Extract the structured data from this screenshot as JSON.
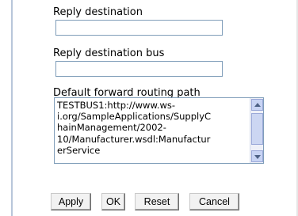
{
  "fields": {
    "reply_destination": {
      "label": "Reply destination",
      "value": ""
    },
    "reply_destination_bus": {
      "label": "Reply destination bus",
      "value": ""
    },
    "default_forward_routing_path": {
      "label": "Default forward routing path",
      "value": "TESTBUS1:http://www.ws-\ni.org/SampleApplications/SupplyC\nhainManagement/2002-\n10/Manufacturer.wsdl:Manufactur\nerService"
    }
  },
  "buttons": {
    "apply": "Apply",
    "ok": "OK",
    "reset": "Reset",
    "cancel": "Cancel"
  },
  "icons": {
    "scroll_up": "triangle-up-icon",
    "scroll_down": "triangle-down-icon"
  }
}
